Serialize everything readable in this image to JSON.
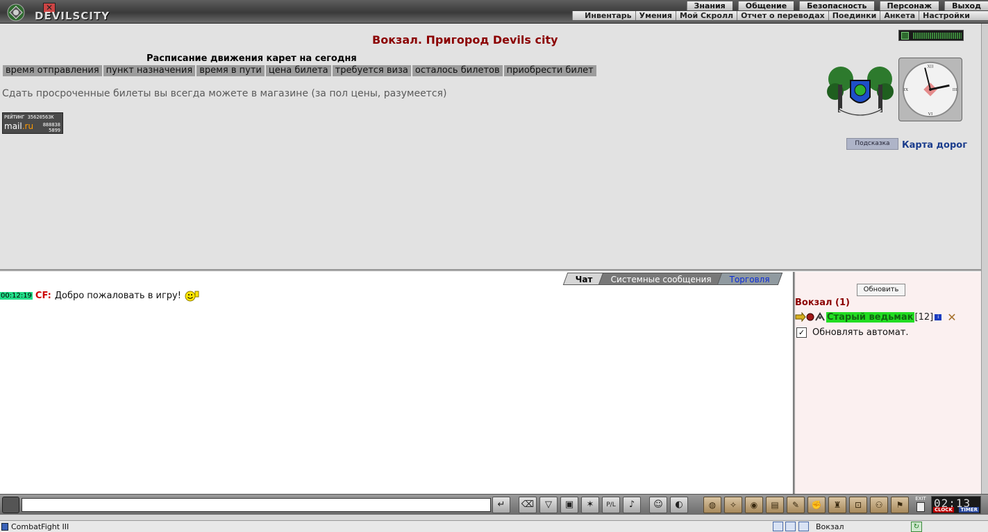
{
  "app": {
    "logo_text": "DEVILSCITY",
    "status_title": "CombatFight III"
  },
  "main_menu": [
    "Знания",
    "Общение",
    "Безопасность",
    "Персонаж",
    "Выход"
  ],
  "sub_menu": [
    "Инвентарь",
    "Умения",
    "Мой Скролл",
    "Отчет о переводах",
    "Поединки",
    "Анкета",
    "Настройки"
  ],
  "page": {
    "title": "Вокзал. Пригород Devils city",
    "schedule_title": "Расписание движения карет на сегодня",
    "schedule_columns": [
      "время отправления",
      "пункт назначения",
      "время в пути",
      "цена билета",
      "требуется виза",
      "осталось билетов",
      "приобрести билет"
    ],
    "notice": "Сдать просроченные билеты вы всегда можете в магазине (за пол цены, разумеется)",
    "counter": {
      "line1": "РЕЙТИНГ 35620563К",
      "brand": "mail",
      "brand_suffix": ".ru",
      "num1": "888838",
      "num2": "5899"
    },
    "hint_button": "Подсказка",
    "roads_link": "Карта дорог"
  },
  "chat": {
    "tabs": [
      {
        "label": "Чат",
        "active": true
      },
      {
        "label": "Системные сообщения",
        "active": false
      },
      {
        "label": "Торговля",
        "active": false
      }
    ],
    "messages": [
      {
        "time": "00:12:19",
        "sender": "CF:",
        "text": "Добро пожаловать в игру!"
      }
    ],
    "input_value": ""
  },
  "online": {
    "refresh_button": "Обновить",
    "location": "Вокзал (1)",
    "player": {
      "name": "Старый ведьмак",
      "level": "[12]",
      "info": "i"
    },
    "auto_refresh": {
      "checked": true,
      "label": "Обновлять автомат."
    }
  },
  "toolbar": {
    "exit_label": "EXIT",
    "clock_time": "02:13",
    "clock_label": "CLOCK",
    "timer_label": "TIMER",
    "pl_label": "P/L"
  },
  "statusbar": {
    "location": "Вокзал"
  },
  "colors": {
    "title_red": "#8b0000",
    "link_blue": "#1a3c8c",
    "player_green": "#22dd22",
    "time_badge": "#22dd88"
  }
}
